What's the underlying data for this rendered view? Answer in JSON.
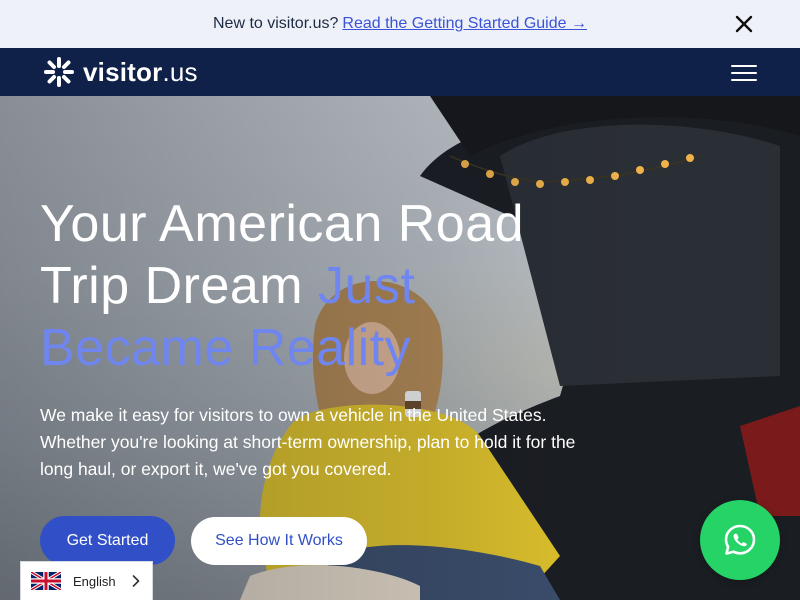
{
  "announcement": {
    "text": "New to visitor.us?",
    "link_label": "Read the Getting Started Guide →"
  },
  "nav": {
    "logo_text_bold": "visitor",
    "logo_text_light": ".us"
  },
  "hero": {
    "headline_white": "Your American Road Trip Dream ",
    "headline_accent": "Just Became Reality",
    "subtext": "We make it easy for visitors to own a vehicle in the United States. Whether you're looking at short-term ownership, plan to hold it for the long haul, or export it, we've got you covered.",
    "primary_button": "Get Started",
    "secondary_button": "See How It Works"
  },
  "language": {
    "selected": "English"
  },
  "icons": {
    "close": "close-icon",
    "menu": "hamburger-menu-icon",
    "chat": "whatsapp-icon",
    "flag": "uk-flag-icon",
    "chevron": "chevron-right-icon"
  },
  "colors": {
    "nav_bg": "#0f2149",
    "accent": "#6f86f0",
    "button_primary": "#3150c8",
    "whatsapp": "#25d366"
  }
}
